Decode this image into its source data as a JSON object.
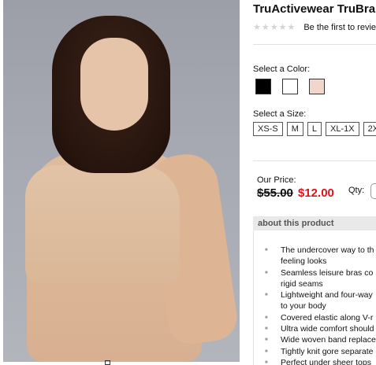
{
  "product": {
    "title": "TruActivewear TruBra",
    "rating_stars": "★★★★★",
    "review_link": "Be the first to revie"
  },
  "colors": {
    "label": "Select a Color:",
    "swatches": [
      "#000000",
      "#ffffff",
      "#f1d6cc"
    ]
  },
  "sizes": {
    "label": "Select a Size:",
    "options": [
      "XS-S",
      "M",
      "L",
      "XL-1X",
      "2X"
    ]
  },
  "price": {
    "label": "Our Price:",
    "old": "$55.00",
    "new": "$12.00",
    "qty_label": "Qty:"
  },
  "about": {
    "heading": "about this product",
    "features": [
      "The undercover way to th",
      "feeling looks",
      "Seamless leisure bras co",
      "rigid seams",
      "Lightweight and four-way",
      "to your body",
      "Covered elastic along V-r",
      "Ultra wide comfort should",
      "Wide woven band replace",
      "Tightly knit gore separate",
      "Perfect under sheer tops"
    ]
  }
}
